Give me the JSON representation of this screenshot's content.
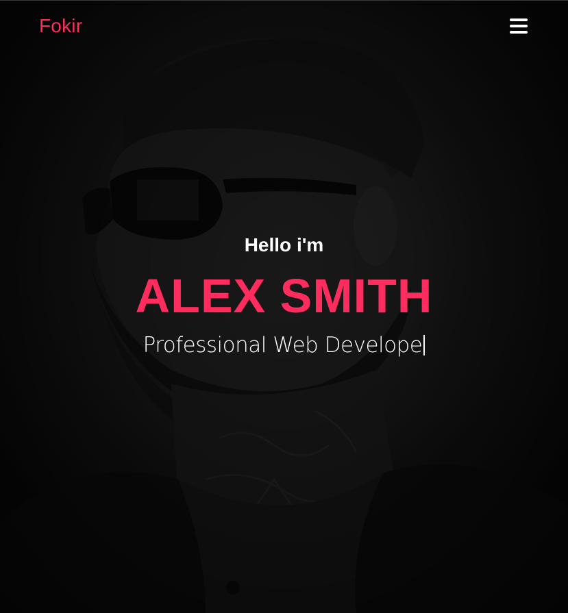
{
  "navbar": {
    "brand": "Fokir",
    "menu_icon": "hamburger-menu-icon"
  },
  "hero": {
    "greeting": "Hello i'm",
    "name": "ALEX SMITH",
    "subtitle": "Professional Web Develope",
    "cursor_icon": "text-cursor-icon"
  },
  "colors": {
    "accent": "#ff2c5e",
    "text": "#ffffff",
    "background": "#0d0d0d"
  }
}
